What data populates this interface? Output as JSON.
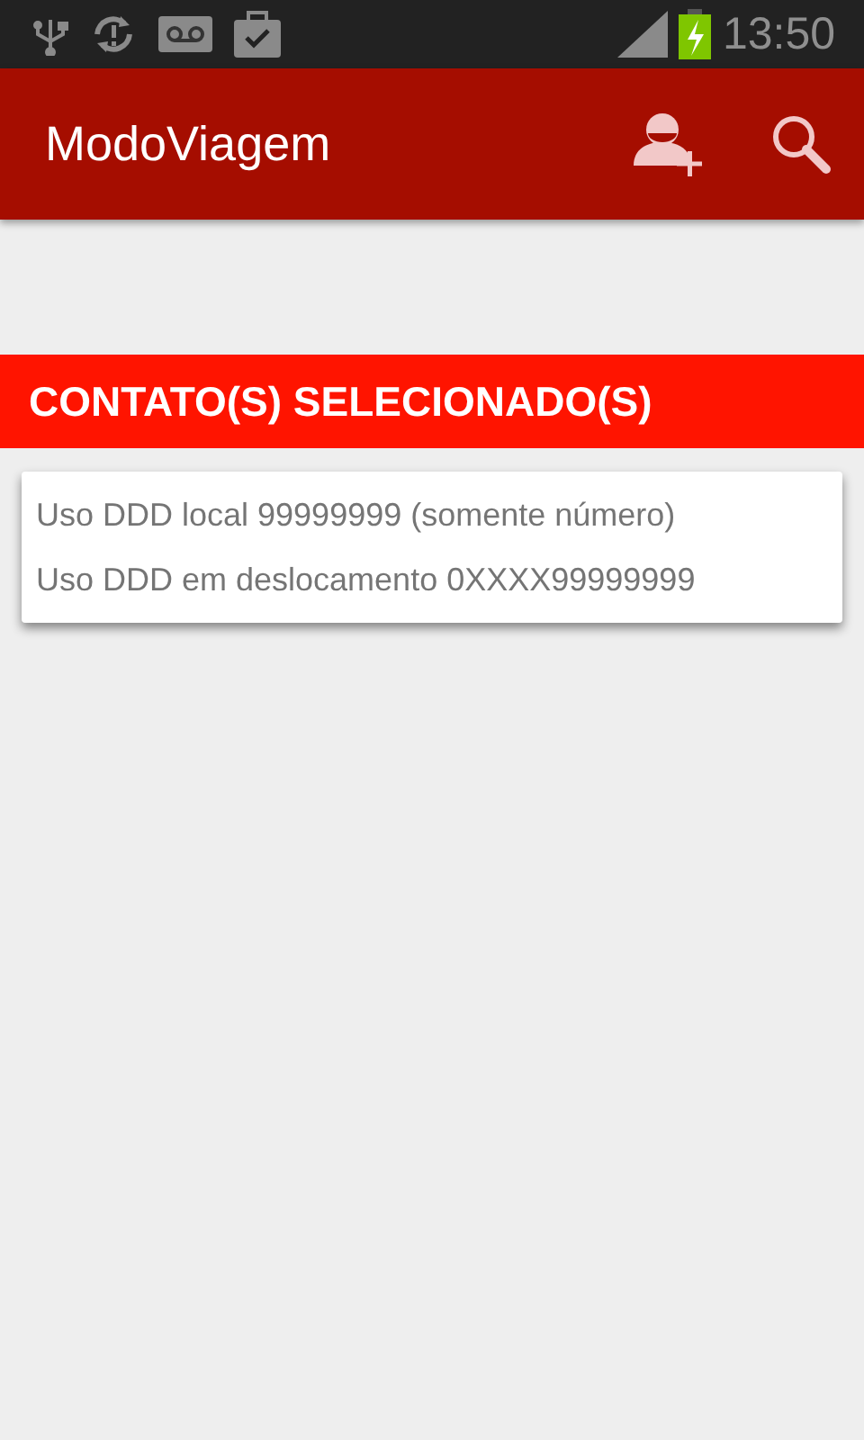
{
  "status_bar": {
    "time": "13:50"
  },
  "app_bar": {
    "title": "ModoViagem"
  },
  "section": {
    "title": "CONTATO(S) SELECIONADO(S)"
  },
  "card": {
    "lines": [
      "Uso DDD local 99999999 (somente número)",
      "Uso DDD em deslocamento 0XXXX99999999"
    ]
  }
}
